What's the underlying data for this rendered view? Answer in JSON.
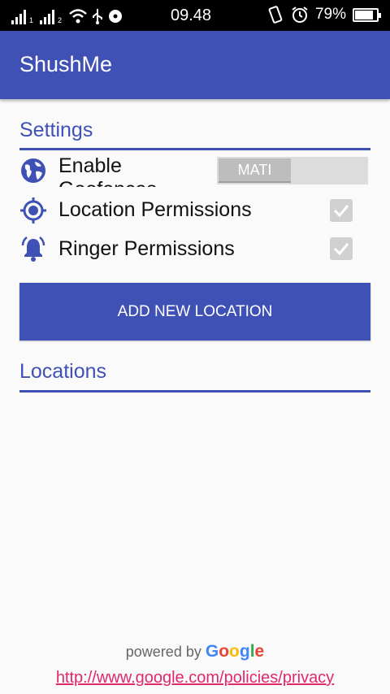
{
  "status_bar": {
    "time": "09.48",
    "battery_percent": "79%",
    "sim1": "1",
    "sim2": "2",
    "battery_level": 0.79
  },
  "app_bar": {
    "title": "ShushMe"
  },
  "settings": {
    "title": "Settings",
    "geofences": {
      "label": "Enable Geofences",
      "toggle_text": "MATI",
      "icon": "globe-icon"
    },
    "location_permissions": {
      "label": "Location Permissions",
      "checked": true,
      "icon": "gps-target-icon"
    },
    "ringer_permissions": {
      "label": "Ringer Permissions",
      "checked": true,
      "icon": "ringing-bell-icon"
    }
  },
  "add_button": {
    "label": "ADD NEW LOCATION"
  },
  "locations": {
    "title": "Locations"
  },
  "footer": {
    "powered_by": "powered by",
    "google": [
      "G",
      "o",
      "o",
      "g",
      "l",
      "e"
    ],
    "google_colors": [
      "#4285f4",
      "#ea4335",
      "#fbbc05",
      "#4285f4",
      "#34a853",
      "#ea4335"
    ],
    "privacy_url": "http://www.google.com/policies/privacy"
  },
  "colors": {
    "primary": "#3f51b5",
    "link": "#e0286d"
  }
}
